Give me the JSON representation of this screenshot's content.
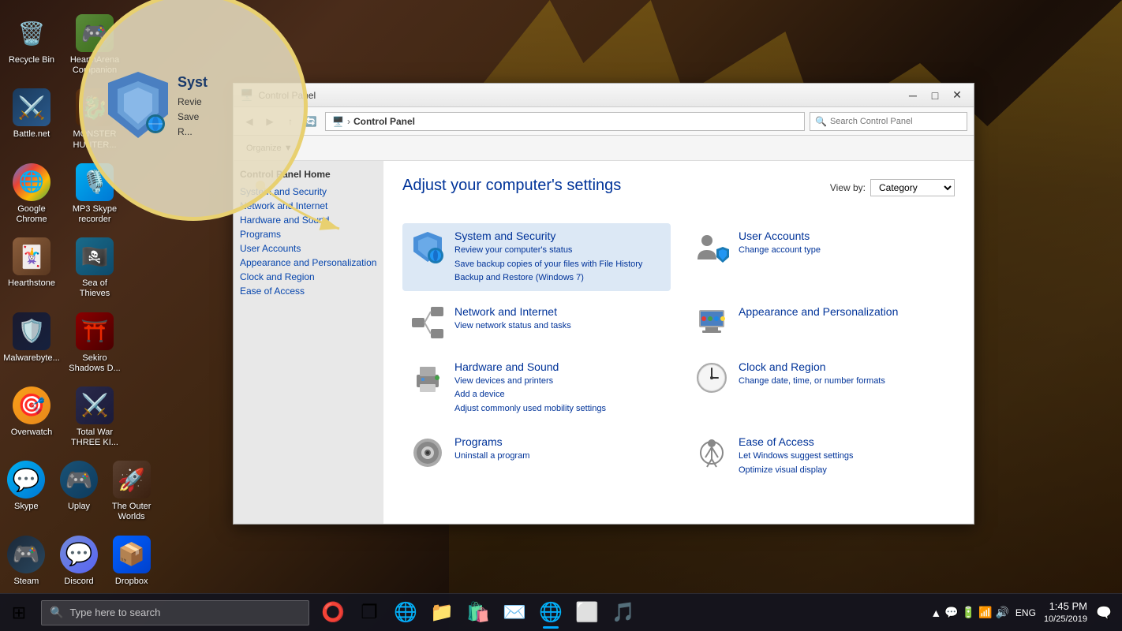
{
  "desktop": {
    "background": "dark fantasy castle"
  },
  "zoom_circle": {
    "title": "Syst",
    "lines": [
      "Revie",
      "Save",
      "R..."
    ]
  },
  "desktop_icons": [
    {
      "id": "recycle-bin",
      "label": "Recycle Bin",
      "emoji": "🗑️",
      "col": 0,
      "row": 0
    },
    {
      "id": "heartharena",
      "label": "HearthArena Companion",
      "emoji": "🎮",
      "col": 1,
      "row": 0
    },
    {
      "id": "battlenet",
      "label": "Battle.net",
      "emoji": "⚔️",
      "col": 0,
      "row": 1
    },
    {
      "id": "monsters",
      "label": "MONSTER HUNTER...",
      "emoji": "🐉",
      "col": 1,
      "row": 1
    },
    {
      "id": "chrome",
      "label": "Google Chrome",
      "emoji": "🌐",
      "col": 0,
      "row": 2
    },
    {
      "id": "mp3skype",
      "label": "MP3 Skype recorder",
      "emoji": "🎙️",
      "col": 1,
      "row": 2
    },
    {
      "id": "hearthstone",
      "label": "Hearthstone",
      "emoji": "🃏",
      "col": 0,
      "row": 3
    },
    {
      "id": "sea-of-thieves",
      "label": "Sea of Thieves",
      "emoji": "🏴‍☠️",
      "col": 1,
      "row": 3
    },
    {
      "id": "malwarebytes",
      "label": "Malwarebyte...",
      "emoji": "🛡️",
      "col": 0,
      "row": 4
    },
    {
      "id": "sekiro",
      "label": "Sekiro Shadows D...",
      "emoji": "⛩️",
      "col": 1,
      "row": 4
    },
    {
      "id": "overwatch",
      "label": "Overwatch",
      "emoji": "🎯",
      "col": 0,
      "row": 5
    },
    {
      "id": "total-war",
      "label": "Total War THREE KI...",
      "emoji": "⚔️",
      "col": 1,
      "row": 5
    },
    {
      "id": "skype",
      "label": "Skype",
      "emoji": "💬",
      "col": 0,
      "row": 6
    },
    {
      "id": "uplay",
      "label": "Uplay",
      "emoji": "🎮",
      "col": 1,
      "row": 6
    },
    {
      "id": "outer-worlds",
      "label": "The Outer Worlds",
      "emoji": "🚀",
      "col": 2,
      "row": 6
    },
    {
      "id": "steam",
      "label": "Steam",
      "emoji": "🎮",
      "col": 0,
      "row": 7
    },
    {
      "id": "discord",
      "label": "Discord",
      "emoji": "💬",
      "col": 1,
      "row": 7
    },
    {
      "id": "dropbox",
      "label": "Dropbox",
      "emoji": "📦",
      "col": 2,
      "row": 7
    }
  ],
  "control_panel": {
    "title": "Control Panel",
    "address_breadcrumb": "Control Panel",
    "search_placeholder": "Search Control Panel",
    "page_title": "Adjust your computer's settings",
    "view_by_label": "View by:",
    "view_by_value": "Category",
    "categories": [
      {
        "id": "system-security",
        "title": "System and Security",
        "links": [
          "Review your computer's status",
          "Save backup copies of your files with File History",
          "Backup and Restore (Windows 7)"
        ],
        "highlighted": true
      },
      {
        "id": "user-accounts",
        "title": "User Accounts",
        "links": [
          "Change account type"
        ]
      },
      {
        "id": "network-internet",
        "title": "Network and Internet",
        "links": [
          "View network status and tasks"
        ]
      },
      {
        "id": "appearance-personalization",
        "title": "Appearance and Personalization",
        "links": []
      },
      {
        "id": "hardware-sound",
        "title": "Hardware and Sound",
        "links": [
          "View devices and printers",
          "Add a device",
          "Adjust commonly used mobility settings"
        ]
      },
      {
        "id": "clock-region",
        "title": "Clock and Region",
        "links": [
          "Change date, time, or number formats"
        ]
      },
      {
        "id": "programs",
        "title": "Programs",
        "links": [
          "Uninstall a program"
        ]
      },
      {
        "id": "ease-of-access",
        "title": "Ease of Access",
        "links": [
          "Let Windows suggest settings",
          "Optimize visual display"
        ]
      }
    ]
  },
  "window_controls": {
    "minimize": "─",
    "maximize": "□",
    "close": "✕"
  },
  "taskbar": {
    "start_icon": "⊞",
    "search_placeholder": "Type here to search",
    "apps": [
      {
        "id": "cortana",
        "emoji": "⭕",
        "active": false
      },
      {
        "id": "task-view",
        "emoji": "❐",
        "active": false
      },
      {
        "id": "edge",
        "emoji": "🌐",
        "active": false
      },
      {
        "id": "explorer",
        "emoji": "📁",
        "active": false
      },
      {
        "id": "store",
        "emoji": "🛍️",
        "active": false
      },
      {
        "id": "mail",
        "emoji": "✉️",
        "active": false
      },
      {
        "id": "edge2",
        "emoji": "🌐",
        "active": true
      },
      {
        "id": "tablet",
        "emoji": "⬜",
        "active": false
      },
      {
        "id": "misc",
        "emoji": "🎵",
        "active": false
      }
    ],
    "tray": {
      "icons": [
        "▲",
        "💬",
        "🔋",
        "📶",
        "🔊"
      ],
      "lang": "ENG",
      "time": "1:45 PM",
      "date": "10/25/2019"
    },
    "notification": "🗨️"
  }
}
